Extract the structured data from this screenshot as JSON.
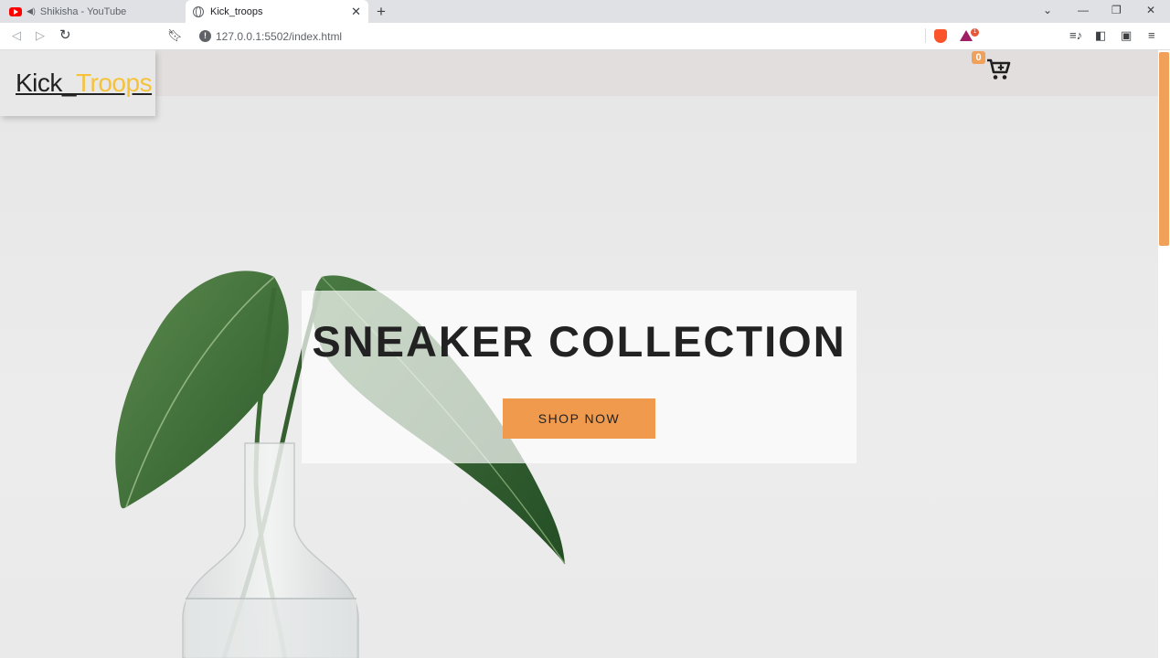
{
  "browser": {
    "tabs": [
      {
        "title": "Shikisha - YouTube",
        "active": false
      },
      {
        "title": "Kick_troops",
        "active": true
      }
    ],
    "url": "127.0.0.1:5502/index.html",
    "bat_badge": "1"
  },
  "site": {
    "logo": {
      "part1": "Kick_",
      "part2": "Troops"
    },
    "cart_count": "0",
    "hero": {
      "title": "SNEAKER COLLECTION",
      "button": "SHOP NOW"
    }
  },
  "colors": {
    "accent_orange": "#f09a4d",
    "logo_yellow": "#f6c23b",
    "header_band": "#e2dedd",
    "text_dark": "#222222"
  },
  "icons": [
    "youtube-icon",
    "speaker-icon",
    "globe-icon",
    "close-icon",
    "plus-icon",
    "back-icon",
    "forward-icon",
    "reload-icon",
    "bookmark-icon",
    "info-icon",
    "brave-icon",
    "bat-icon",
    "playlist-icon",
    "sidebar-icon",
    "wallet-icon",
    "menu-icon",
    "cart-plus-icon"
  ]
}
